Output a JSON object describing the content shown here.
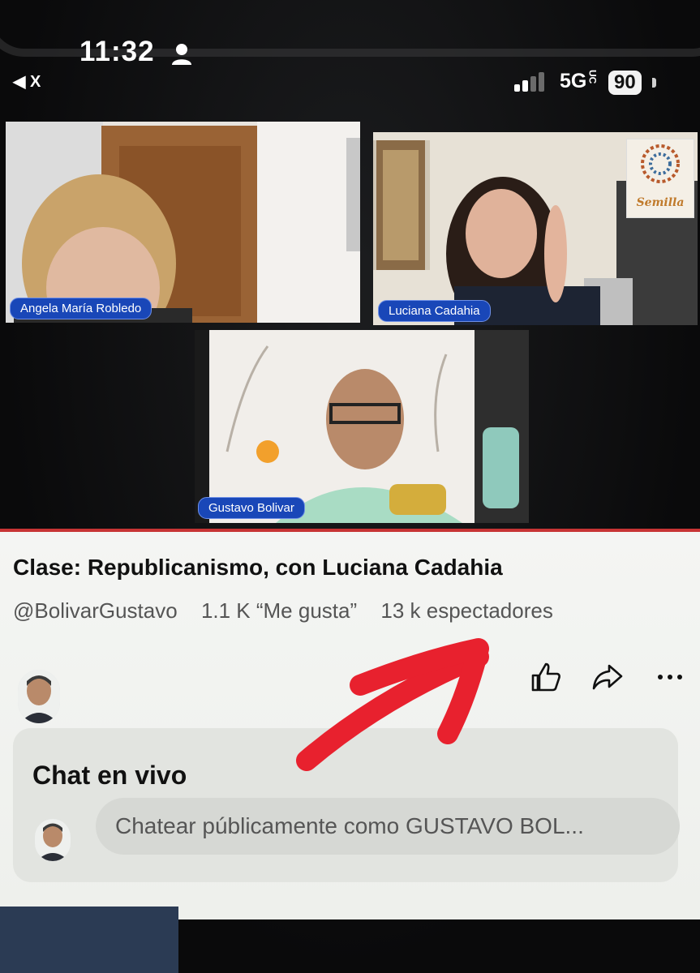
{
  "status_bar": {
    "time": "11:32",
    "back_label": "X",
    "network": "5G",
    "network_sub": "UC",
    "battery": "90"
  },
  "participants": [
    {
      "name": "Angela María Robledo"
    },
    {
      "name": "Luciana Cadahia"
    },
    {
      "name": "Gustavo Bolivar"
    }
  ],
  "logo_text": "Semilla",
  "video": {
    "title": "Clase: Republicanismo, con Luciana Cadahia",
    "channel": "@BolivarGustavo",
    "likes": "1.1 K “Me gusta”",
    "viewers": "13 k espectadores"
  },
  "actions": {
    "icons": [
      "thumbs-up-icon",
      "share-icon",
      "more-icon"
    ]
  },
  "chat": {
    "title": "Chat en vivo",
    "placeholder": "Chatear públicamente como GUSTAVO BOL..."
  },
  "colors": {
    "name_tag": "#1947b8",
    "arrow": "#e8212e",
    "panel_background": "#f2f3f0"
  }
}
